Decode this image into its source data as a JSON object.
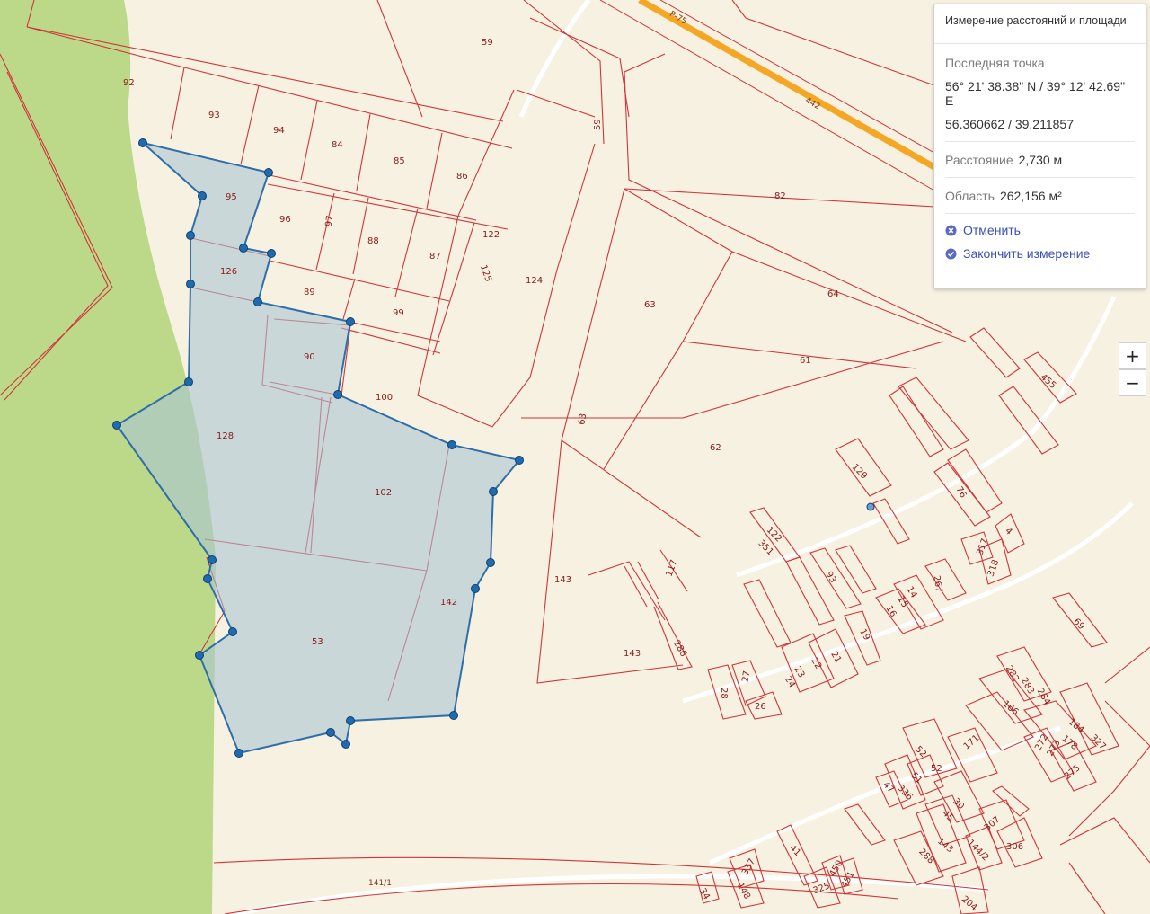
{
  "panel": {
    "title": "Измерение расстояний и площади",
    "last_point_label": "Последняя точка",
    "coords_dms": "56° 21' 38.38\" N / 39° 12' 42.69\" E",
    "coords_dec": "56.360662 / 39.211857",
    "distance_label": "Расстояние",
    "distance_value": "2,730 м",
    "area_label": "Область",
    "area_value": "262,156 м²",
    "cancel_label": "Отменить",
    "finish_label": "Закончить измерение"
  },
  "zoom": {
    "in_label": "+",
    "out_label": "−"
  },
  "roads": {
    "r75": "Р-75",
    "r442": "442",
    "r141": "141/1"
  },
  "colors": {
    "parcel": "#d0353a",
    "measure_fill": "#a9c4d4",
    "measure_line": "#2f6ea8",
    "forest": "#bcd98a",
    "road": "#f5a623"
  },
  "parcels": [
    "92",
    "93",
    "94",
    "84",
    "85",
    "86",
    "59",
    "59",
    "95",
    "96",
    "97",
    "88",
    "87",
    "122",
    "125",
    "124",
    "82",
    "126",
    "89",
    "99",
    "63",
    "64",
    "61",
    "90",
    "100",
    "128",
    "62",
    "63",
    "102",
    "129",
    "76",
    "122",
    "351",
    "117",
    "143",
    "93",
    "267",
    "14",
    "15",
    "16",
    "317",
    "318",
    "4",
    "455",
    "142",
    "143",
    "286",
    "19",
    "21",
    "22",
    "23",
    "24",
    "27",
    "28",
    "26",
    "69",
    "53",
    "282",
    "283",
    "284",
    "166",
    "184",
    "178",
    "327",
    "272",
    "273",
    "275",
    "171",
    "52",
    "51",
    "52",
    "47",
    "336",
    "30",
    "45",
    "307",
    "306",
    "143",
    "144/2",
    "288",
    "41",
    "337",
    "148",
    "34",
    "450",
    "451",
    "325",
    "204"
  ]
}
